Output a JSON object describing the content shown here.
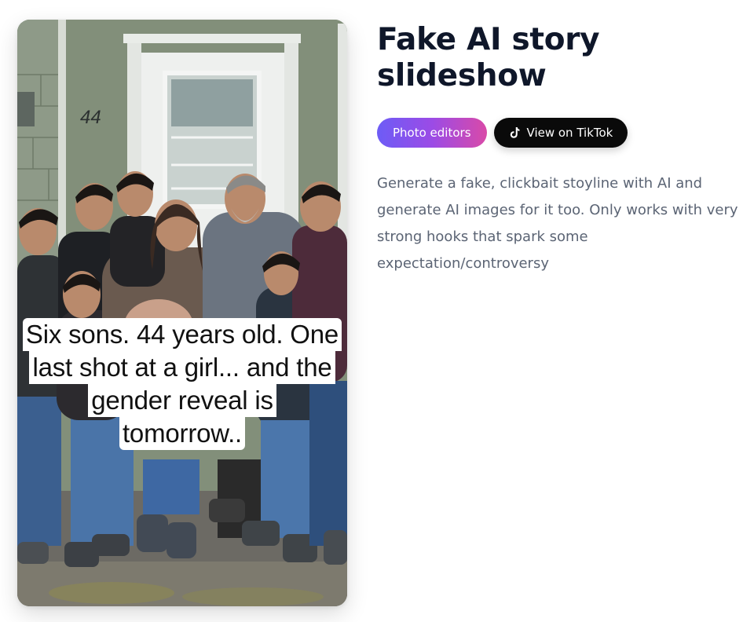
{
  "card": {
    "image_alt": "Family of eight posing in front of a house door",
    "house_number": "44",
    "caption_lines": [
      "Six sons. 44 years old. One",
      "last shot at a girl... and the",
      "gender reveal is",
      "tomorrow.."
    ]
  },
  "detail": {
    "title": "Fake AI story slideshow",
    "tags": [
      {
        "label": "Photo editors",
        "icon": null
      },
      {
        "label": "View on TikTok",
        "icon": "tiktok-icon"
      }
    ],
    "description": "Generate a fake, clickbait stoyline with AI and generate AI images for it too. Only works with very strong hooks that spark some expectation/controversy"
  },
  "colors": {
    "title": "#0f172a",
    "description": "#5b6474",
    "tag_gradient_start": "#6d5cf6",
    "tag_gradient_end": "#d94aa8",
    "tiktok_button": "#0a0a0a"
  }
}
